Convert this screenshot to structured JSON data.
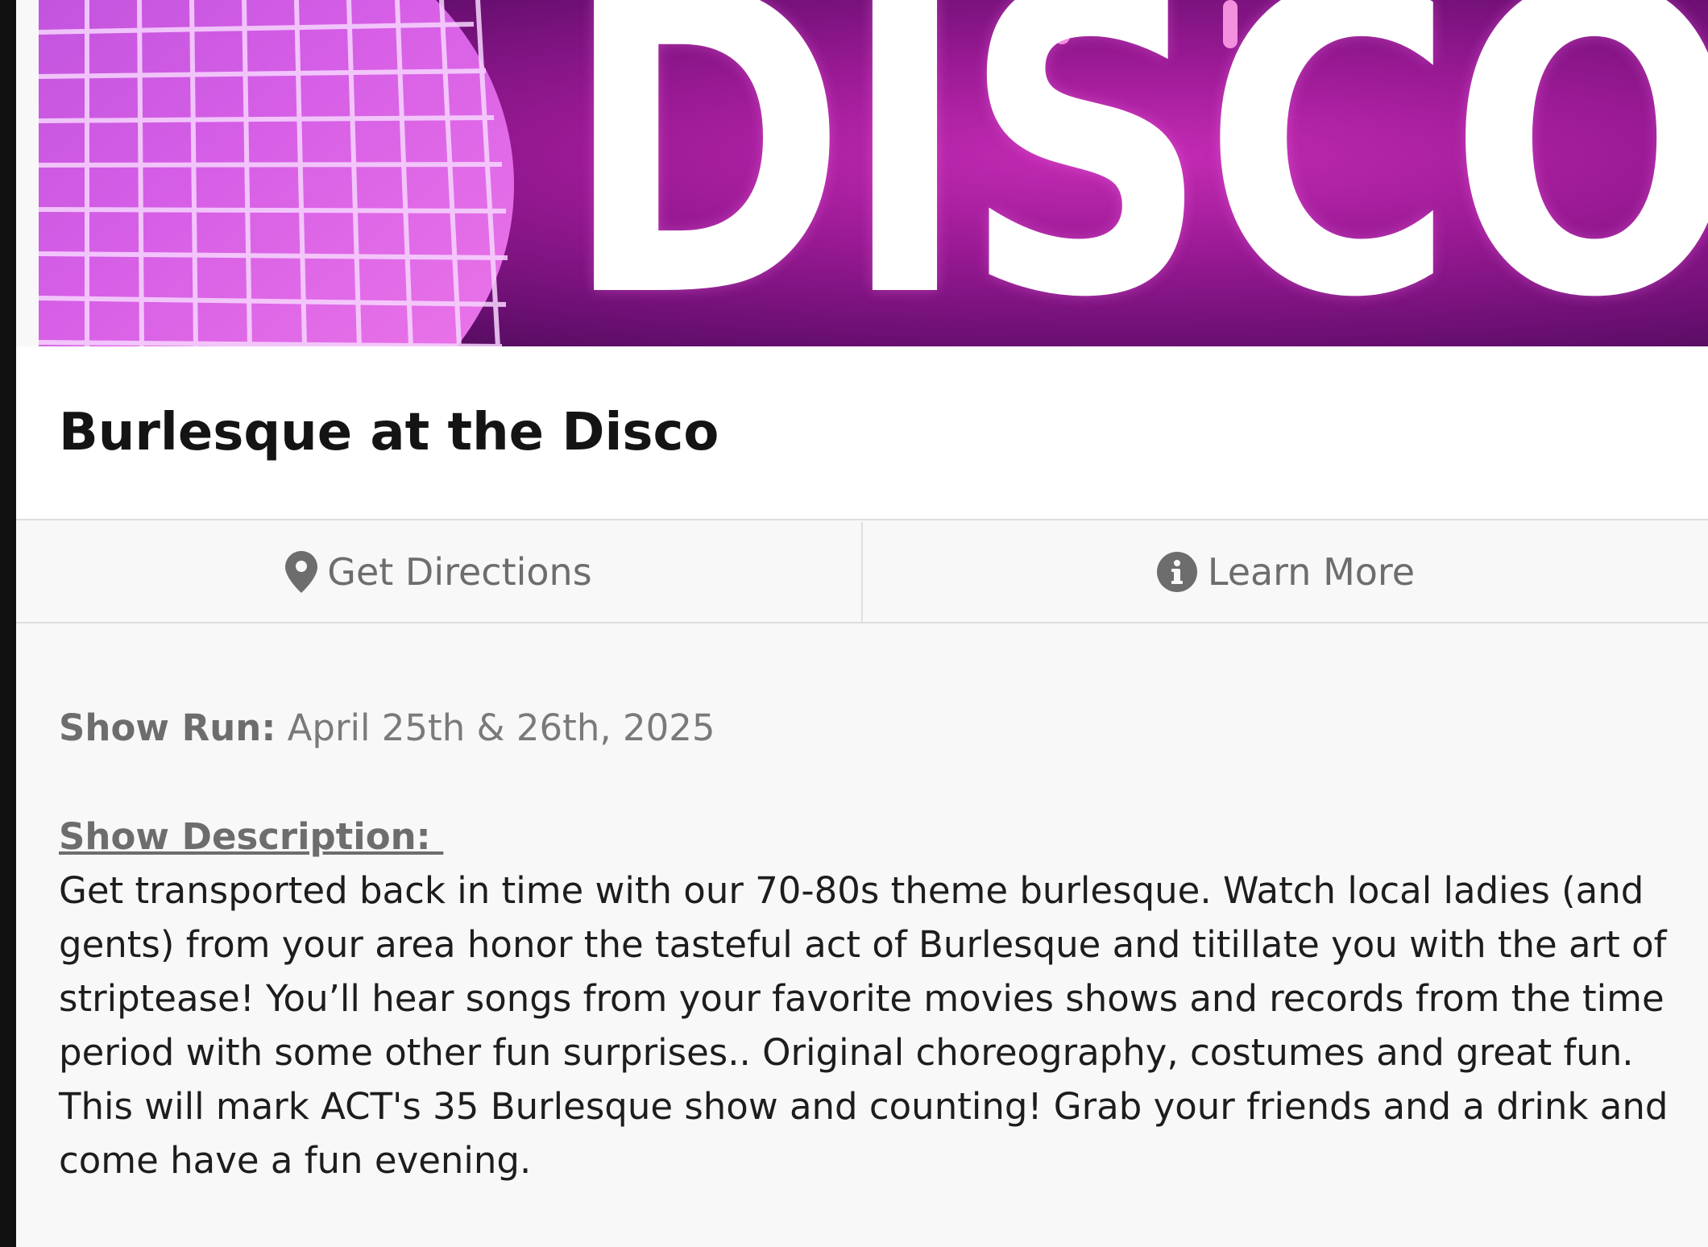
{
  "hero": {
    "image_text": "DISCO",
    "colors": {
      "magenta": "#c42cb4",
      "deep_purple": "#3d0a4a",
      "mirror_ball": "#e58cf0"
    }
  },
  "event": {
    "title": "Burlesque at the Disco"
  },
  "actions": {
    "directions": {
      "label": "Get Directions",
      "icon": "map-pin-icon"
    },
    "learn_more": {
      "label": "Learn More",
      "icon": "info-circle-icon"
    }
  },
  "details": {
    "show_run_label": "Show Run:",
    "show_run_value": " April 25th & 26th, 2025",
    "description_label": "Show Description: ",
    "description_text": "Get transported back in time with our 70-80s theme burlesque. Watch local ladies (and gents) from your area honor the tasteful act of Burlesque and titillate you with the art of striptease! You’ll hear songs from your favorite movies shows and records from the time period with some other fun surprises.. Original choreography, costumes and great fun. This will mark ACT's 35 Burlesque show and counting! Grab your friends and a drink and come have a fun evening."
  },
  "theme": {
    "text_muted": "#6d6d6d",
    "text_dark": "#141414",
    "divider": "#dedede",
    "panel_bg": "#f8f8f8"
  }
}
